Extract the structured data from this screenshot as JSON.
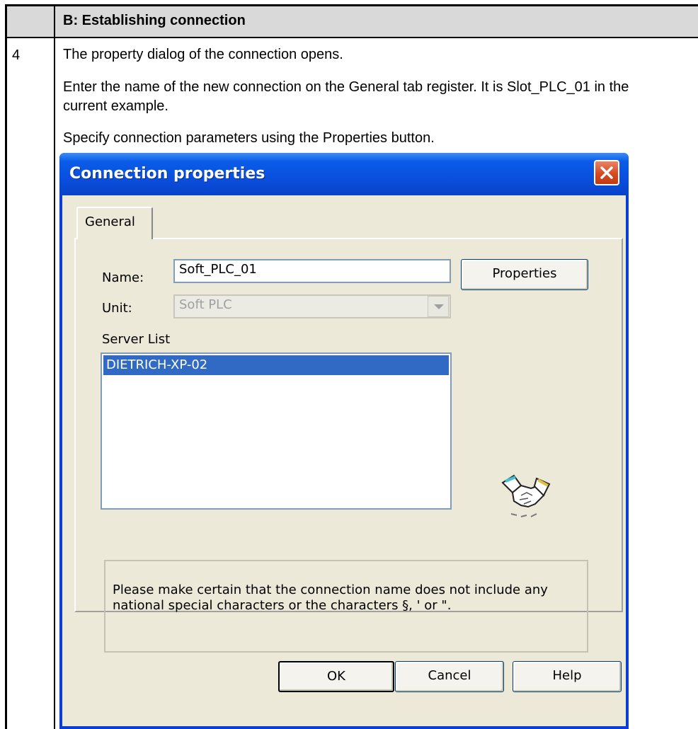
{
  "table": {
    "header_title": "B: Establishing connection",
    "step_number": "4",
    "paragraphs": [
      "The property dialog of the connection opens.",
      "Enter the name of the new connection on the General tab register. It is Slot_PLC_01 in the current example.",
      "Specify connection parameters using the Properties button."
    ]
  },
  "dialog": {
    "title": "Connection properties",
    "tab_general": "General",
    "name_label": "Name:",
    "name_value": "Soft_PLC_01",
    "unit_label": "Unit:",
    "unit_value": "Soft PLC",
    "properties_button": "Properties",
    "server_list_label": "Server List",
    "server_list_items": [
      "DIETRICH-XP-02"
    ],
    "note": "Please make certain that the connection name does not include any national special characters or the characters §, ' or \".",
    "ok_button": "OK",
    "cancel_button": "Cancel",
    "help_button": "Help"
  },
  "colors": {
    "header_background": "#d9d9d9",
    "titlebar_blue": "#0a4fde",
    "selection_blue": "#316ac5",
    "dialog_face": "#ece9d8",
    "close_red": "#d8491f"
  }
}
